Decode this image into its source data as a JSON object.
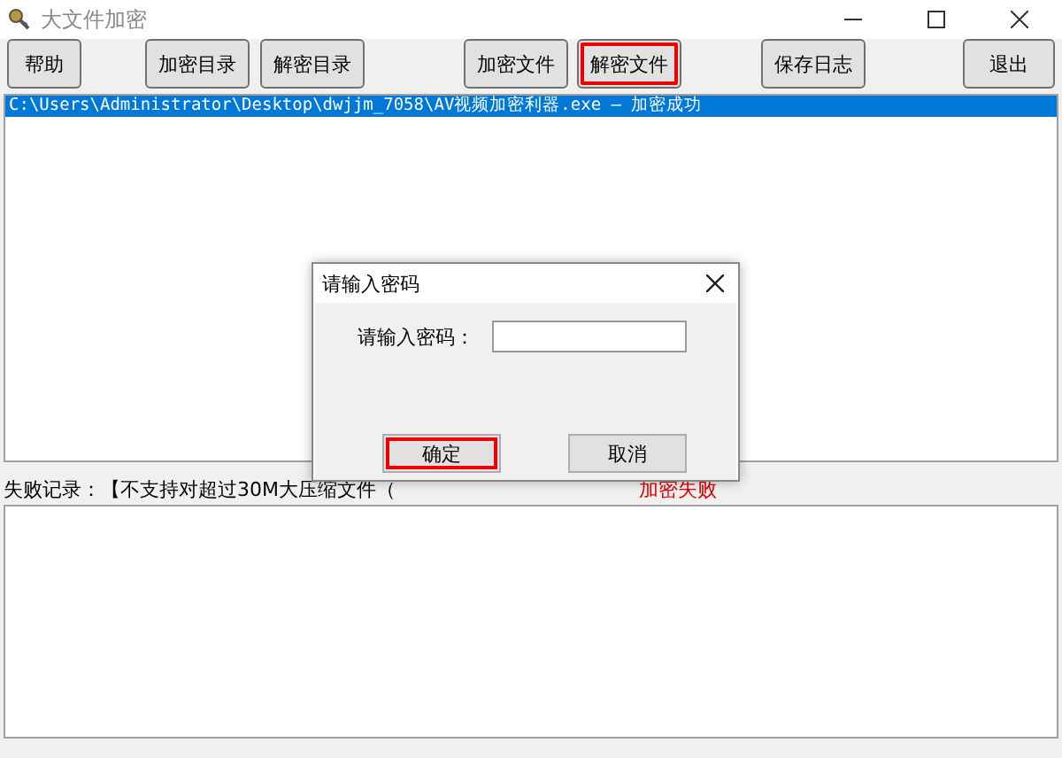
{
  "window": {
    "title": "大文件加密"
  },
  "toolbar": [
    {
      "label": "帮助",
      "highlighted": false
    },
    {
      "label": "加密目录",
      "highlighted": false
    },
    {
      "label": "解密目录",
      "highlighted": false
    },
    {
      "label": "加密文件",
      "highlighted": false
    },
    {
      "label": "解密文件",
      "highlighted": true
    },
    {
      "label": "保存日志",
      "highlighted": false
    },
    {
      "label": "退出",
      "highlighted": false
    }
  ],
  "log": [
    {
      "text": "C:\\Users\\Administrator\\Desktop\\dwjjm_7058\\AV视频加密利器.exe — 加密成功",
      "selected": true
    }
  ],
  "failure": {
    "label": "失败记录：【不支持对超过30M大压缩文件（",
    "status": "加密失败"
  },
  "dialog": {
    "title": "请输入密码",
    "field_label": "请输入密码：",
    "buttons": [
      {
        "label": "确定",
        "highlighted": true
      },
      {
        "label": "取消",
        "highlighted": false
      }
    ]
  }
}
